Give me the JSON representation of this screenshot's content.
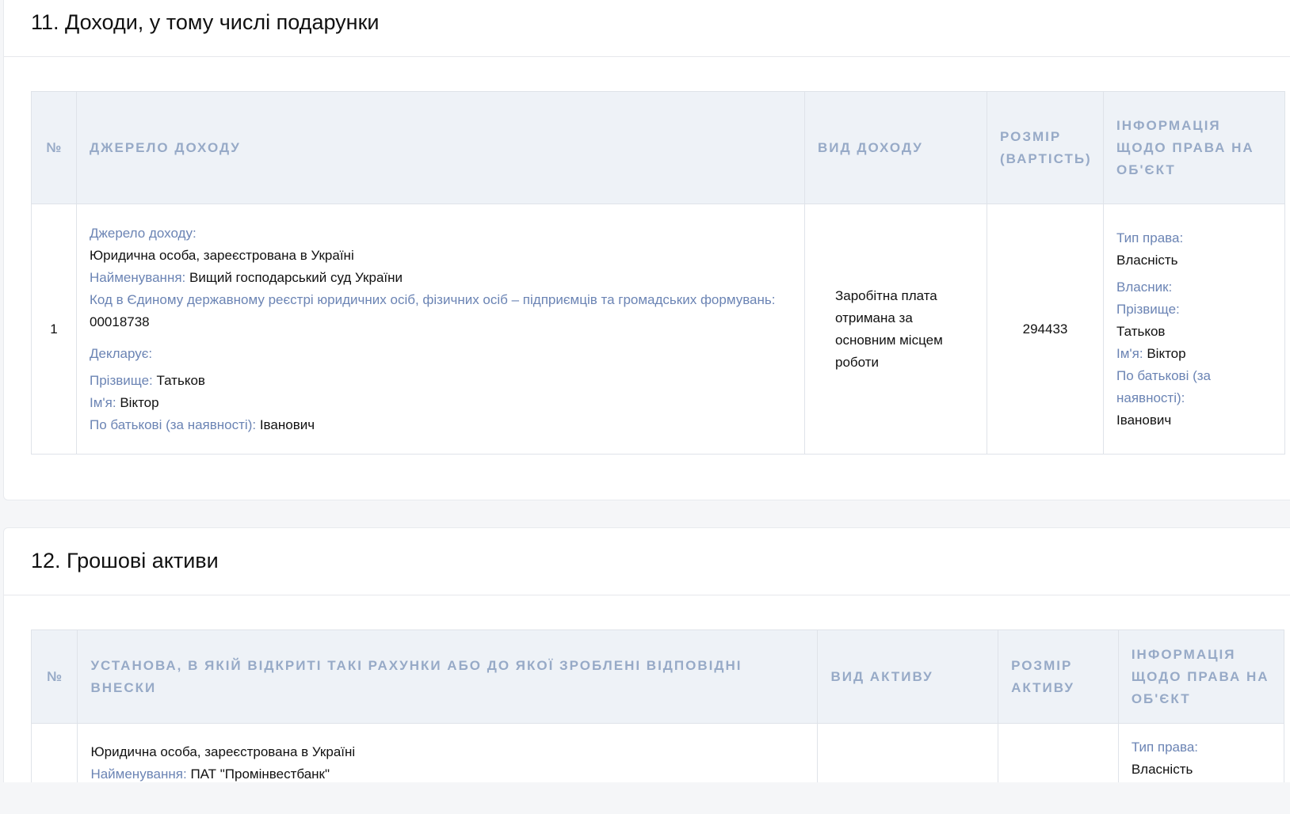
{
  "section11": {
    "title": "11. Доходи, у тому числі подарунки",
    "headers": {
      "num": "№",
      "source": "Джерело доходу",
      "type": "Вид доходу",
      "amount": "Розмір (вартість)",
      "rights": "Інформація щодо права на об'єкт"
    },
    "row": {
      "num": "1",
      "source_label": "Джерело доходу:",
      "source_entity": "Юридична особа, зареєстрована в Україні",
      "name_label": "Найменування:",
      "name_value": "Вищий господарський суд України",
      "code_label": "Код в Єдиному державному реєстрі юридичних осіб, фізичних осіб – підприємців та громадських формувань:",
      "code_value": "00018738",
      "declarant_label": "Декларує:",
      "surname_label": "Прізвище:",
      "surname_value": "Татьков",
      "firstname_label": "Ім'я:",
      "firstname_value": "Віктор",
      "patronymic_label": "По батькові (за наявності):",
      "patronymic_value": "Іванович",
      "income_type": "Заробітна плата отримана за основним місцем роботи",
      "amount": "294433",
      "right_type_label": "Тип права:",
      "right_type_value": "Власність",
      "owner_label": "Власник:",
      "owner_surname_label": "Прізвище:",
      "owner_surname_value": "Татьков",
      "owner_firstname_label": "Ім'я:",
      "owner_firstname_value": "Віктор",
      "owner_patronymic_label": "По батькові (за наявності):",
      "owner_patronymic_value": "Іванович"
    }
  },
  "section12": {
    "title": "12. Грошові активи",
    "headers": {
      "num": "№",
      "institution": "Установа, в якій відкриті такі рахунки або до якої зроблені відповідні внески",
      "type": "Вид активу",
      "amount": "Розмір активу",
      "rights": "Інформація щодо права на об'єкт"
    },
    "row": {
      "entity": "Юридична особа, зареєстрована в Україні",
      "name_label": "Найменування:",
      "name_value": "ПАТ \"Промінвестбанк\"",
      "right_type_label": "Тип права:",
      "right_type_value": "Власність"
    }
  }
}
